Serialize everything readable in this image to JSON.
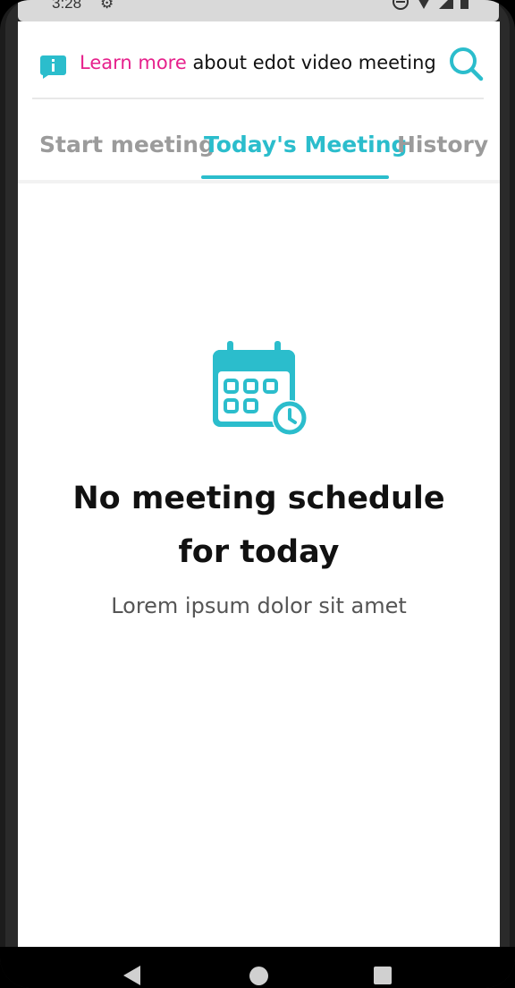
{
  "status_bar": {
    "time": "3:28",
    "gear_icon": "gear-icon",
    "dnd_icon": "do-not-disturb-icon",
    "wifi_icon": "wifi-icon",
    "signal_icon": "signal-icon",
    "battery_icon": "battery-icon"
  },
  "header": {
    "info_icon": "info-chat-icon",
    "learn_more_link": "Learn more",
    "learn_more_rest": " about edot video meeting",
    "search_icon": "search-icon",
    "link_color": "#e6218c"
  },
  "tabs": [
    {
      "label": "Start meeting",
      "active": false
    },
    {
      "label": "Today's Meeting",
      "active": true
    },
    {
      "label": "History",
      "active": false
    }
  ],
  "accent_color": "#2bbdcc",
  "empty_state": {
    "icon": "calendar-clock-icon",
    "title": "No meeting schedule for today",
    "subtitle": "Lorem ipsum dolor sit amet"
  },
  "nav_bar": {
    "back_icon": "back-icon",
    "home_icon": "home-icon",
    "recent_icon": "recent-apps-icon"
  }
}
